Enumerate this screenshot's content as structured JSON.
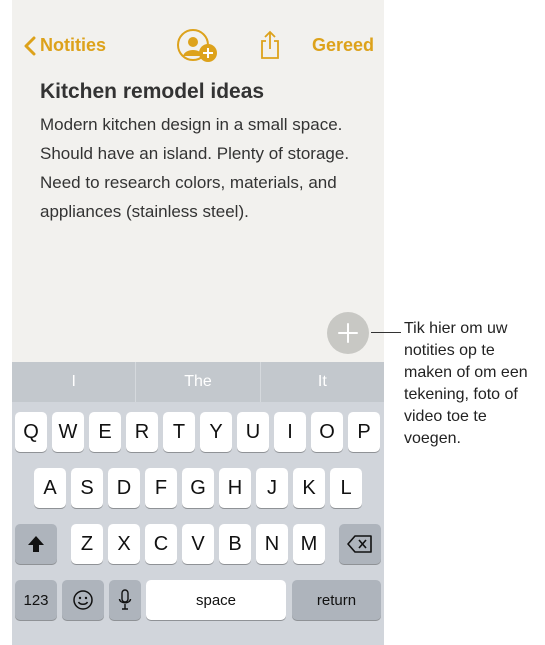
{
  "navbar": {
    "back_label": "Notities",
    "done_label": "Gereed"
  },
  "note": {
    "title": "Kitchen remodel ideas",
    "body": "Modern kitchen design in a small space. Should have an island. Plenty of storage. Need to research colors, materials, and appliances (stainless steel)."
  },
  "predictive": [
    "I",
    "The",
    "It"
  ],
  "keyboard": {
    "row1": [
      "Q",
      "W",
      "E",
      "R",
      "T",
      "Y",
      "U",
      "I",
      "O",
      "P"
    ],
    "row2": [
      "A",
      "S",
      "D",
      "F",
      "G",
      "H",
      "J",
      "K",
      "L"
    ],
    "row3": [
      "Z",
      "X",
      "C",
      "V",
      "B",
      "N",
      "M"
    ],
    "numbers_label": "123",
    "space_label": "space",
    "return_label": "return"
  },
  "callout": "Tik hier om uw notities op te maken of om een tekening, foto of video toe te voegen.",
  "colors": {
    "accent": "#dda21b",
    "keyboard_bg": "#d1d5db",
    "note_bg": "#f2f1ee"
  },
  "icons": [
    "chevron-left-icon",
    "add-person-icon",
    "share-icon",
    "plus-icon",
    "shift-icon",
    "delete-icon",
    "emoji-icon",
    "microphone-icon"
  ]
}
